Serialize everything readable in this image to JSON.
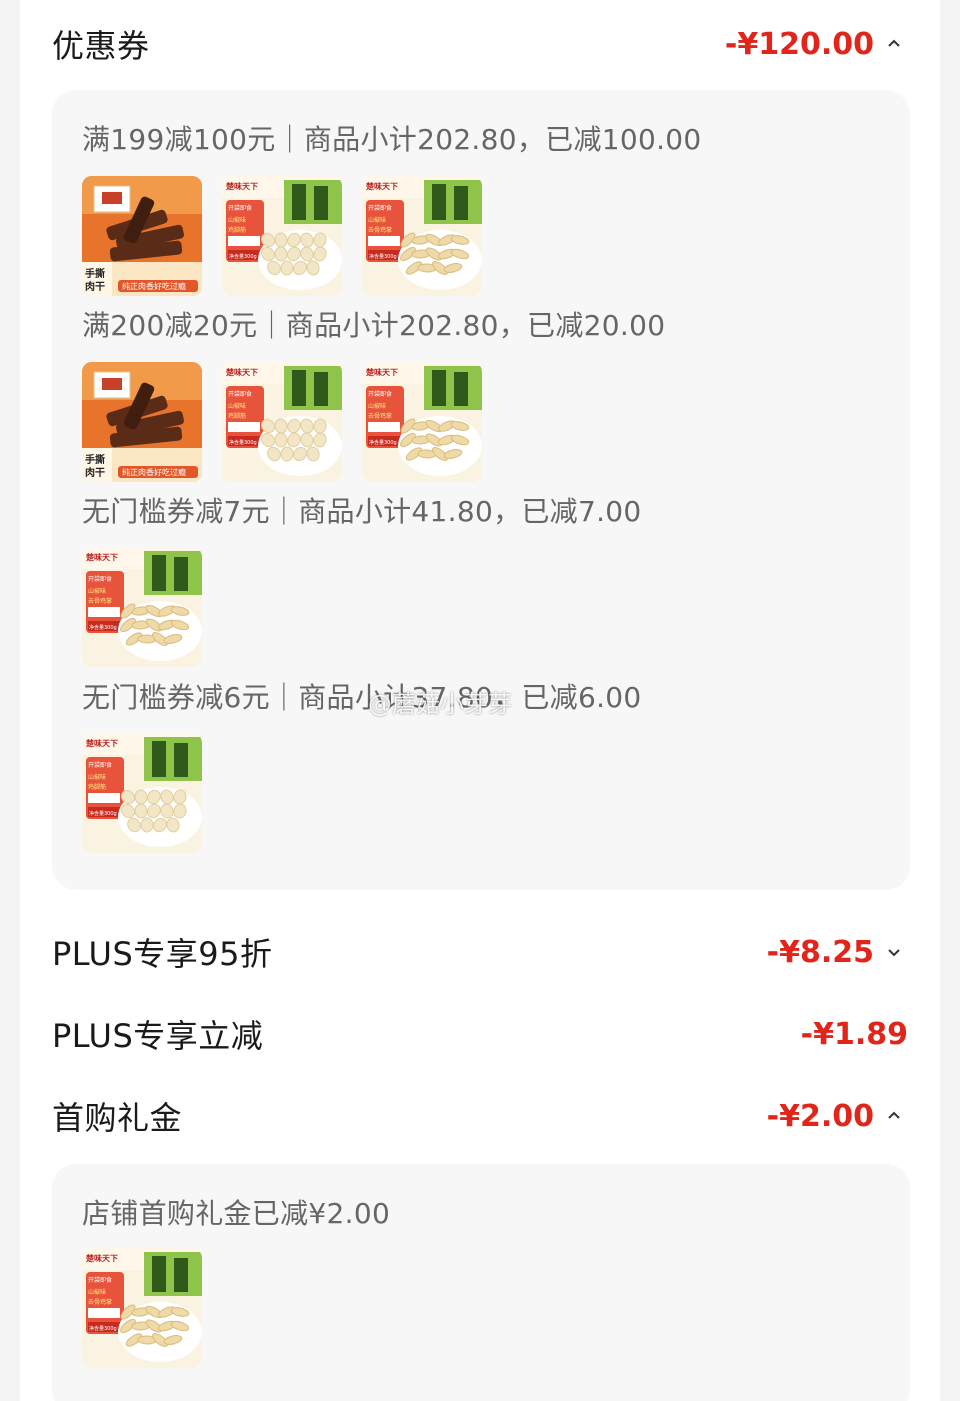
{
  "coupon": {
    "title": "优惠券",
    "amount": "-¥120.00",
    "groups": [
      {
        "label": "满199减100元｜商品小计202.80，已减100.00",
        "products": [
          "jerky",
          "chicken-feet",
          "deboned-feet"
        ]
      },
      {
        "label": "满200减20元｜商品小计202.80，已减20.00",
        "products": [
          "jerky",
          "chicken-feet",
          "deboned-feet"
        ]
      },
      {
        "label": "无门槛券减7元｜商品小计41.80，已减7.00",
        "products": [
          "deboned-feet"
        ]
      },
      {
        "label": "无门槛券减6元｜商品小计37.80，已减6.00",
        "products": [
          "chicken-feet"
        ]
      }
    ]
  },
  "plus95": {
    "title": "PLUS专享95折",
    "amount": "-¥8.25"
  },
  "plusCut": {
    "title": "PLUS专享立减",
    "amount": "-¥1.89"
  },
  "firstGift": {
    "title": "首购礼金",
    "amount": "-¥2.00",
    "detail": "店铺首购礼金已减¥2.00",
    "products": [
      "deboned-feet"
    ]
  },
  "watermark": "@蘑菇小芽芽",
  "product_labels": {
    "brand": "楚味天下",
    "jerky_tag": "手撕肉干",
    "jerky_slogan": "纯正肉香好吃过瘾",
    "cf_name": "山椒味鸡脚筋",
    "df_name": "山椒味去骨鸡掌",
    "open_eat": "开袋即食",
    "net": "净含量300g"
  },
  "colors": {
    "accent": "#e1251b",
    "panel": "#f7f7f7",
    "muted": "#666666"
  }
}
